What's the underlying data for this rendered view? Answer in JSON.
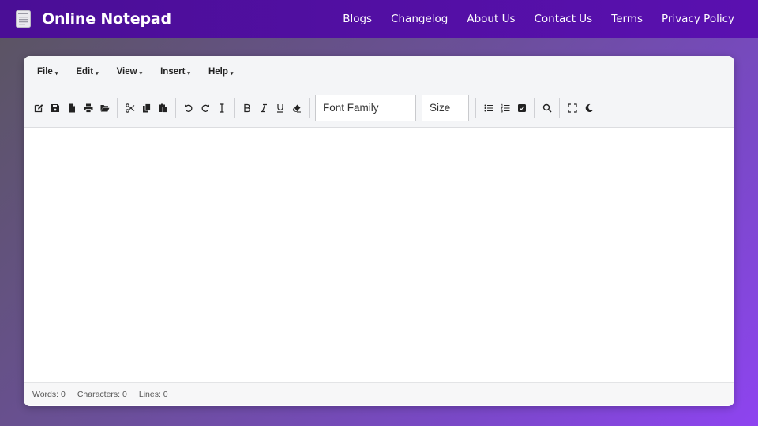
{
  "app": {
    "title": "Online Notepad",
    "logo_icon": "notepad-icon"
  },
  "nav": {
    "links": [
      "Blogs",
      "Changelog",
      "About Us",
      "Contact Us",
      "Terms",
      "Privacy Policy"
    ]
  },
  "menu": {
    "items": [
      "File",
      "Edit",
      "View",
      "Insert",
      "Help"
    ],
    "caret": "▾"
  },
  "toolbar": {
    "groups": [
      [
        "new-note-icon",
        "save-icon",
        "file-icon",
        "print-icon",
        "folder-open-icon"
      ],
      [
        "cut-icon",
        "copy-icon",
        "paste-icon"
      ],
      [
        "undo-icon",
        "redo-icon",
        "text-cursor-icon"
      ],
      [
        "bold-icon",
        "italic-icon",
        "underline-icon",
        "eraser-icon"
      ]
    ],
    "groups_after": [
      [
        "bullet-list-icon",
        "numbered-list-icon",
        "checkbox-icon"
      ],
      [
        "search-icon"
      ],
      [
        "fullscreen-icon",
        "moon-icon"
      ]
    ],
    "font_family_placeholder": "Font Family",
    "size_placeholder": "Size"
  },
  "editor": {
    "content": ""
  },
  "status": {
    "words": "Words: 0",
    "characters": "Characters: 0",
    "lines": "Lines: 0"
  },
  "colors": {
    "navbar": "#4a0e96",
    "accent": "#8e44f0",
    "toolbar_bg": "#f4f5f7"
  }
}
